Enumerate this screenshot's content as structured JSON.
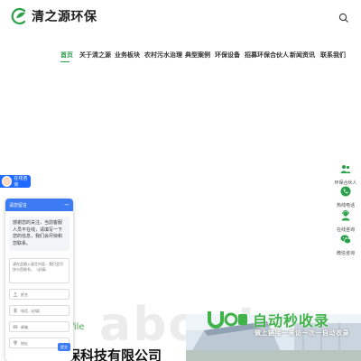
{
  "header": {
    "logo_text": "清之源环保",
    "logo_icon": "leaf-c-logo",
    "search_icon": "search-icon"
  },
  "nav": {
    "items": [
      {
        "label": "首页",
        "active": true
      },
      {
        "label": "关于清之源",
        "active": false
      },
      {
        "label": "业务板块",
        "active": false
      },
      {
        "label": "农村污水治理",
        "active": false
      },
      {
        "label": "典型案例",
        "active": false
      },
      {
        "label": "环保设备",
        "active": false
      },
      {
        "label": "招募环保合伙人",
        "active": false
      },
      {
        "label": "新闻资讯",
        "active": false
      },
      {
        "label": "联系我们",
        "active": false
      }
    ]
  },
  "about": {
    "bg_text": "about us",
    "profile_text": "profile",
    "company_name": "清之源环保科技有限公司"
  },
  "watermark": {
    "brand": "自动秒收录",
    "slogan": "做上链接一来访一次一自动收录"
  },
  "side_bar": {
    "items": [
      {
        "label": "环保合伙人",
        "icon": "partner-icon"
      },
      {
        "label": "热线电话",
        "icon": "phone-icon"
      },
      {
        "label": "在线咨询",
        "icon": "consult-icon"
      },
      {
        "label": "微信咨询",
        "icon": "wechat-icon"
      }
    ]
  },
  "chat": {
    "badge_text": "在线咨询",
    "title": "请您留言",
    "close_label": "−",
    "message": "感谢您的关注，当前客服人员不在线，请填写一下您的信息，我们会尽快和您联系。",
    "textarea_placeholder": "请在此输入留言内容，我们会尽快与您联系。（必填）",
    "name_placeholder": "姓名",
    "phone_placeholder": "电话（必填）",
    "email_placeholder": "邮箱",
    "address_placeholder": "地址",
    "submit_label": "提交"
  },
  "colors": {
    "brand_green": "#2aa14a",
    "chat_blue": "#3c7bf3"
  }
}
